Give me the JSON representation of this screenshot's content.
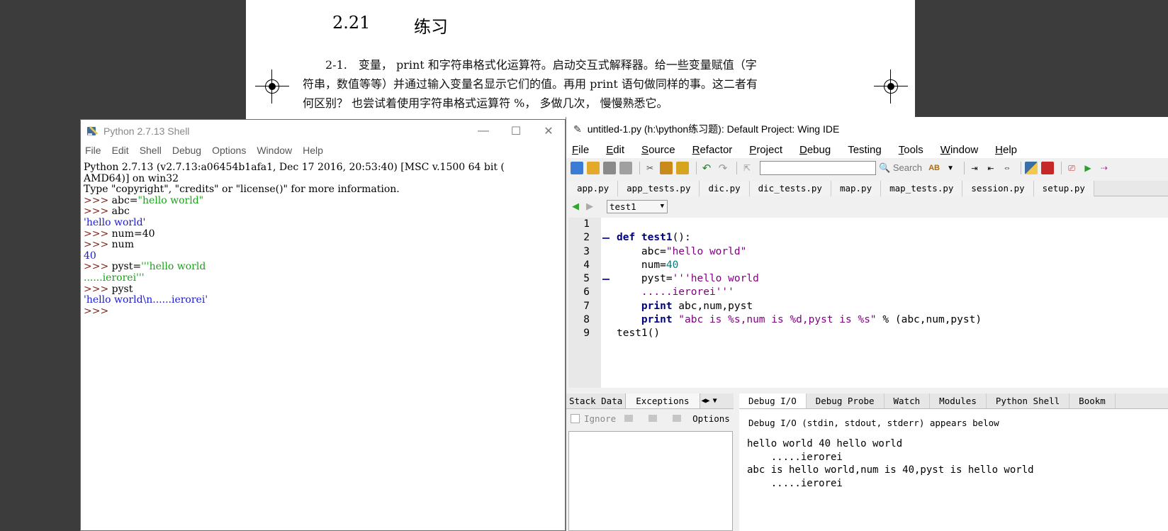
{
  "doc": {
    "heading_num": "2.21",
    "heading_title": "练习",
    "lines": [
      "　　2-1.　变量， print 和字符串格式化运算符。启动交互式解释器。给一些变量赋值（字",
      "符串，数值等等）并通过输入变量名显示它们的值。再用 print 语句做同样的事。这二者有",
      "何区别？ 也尝试着使用字符串格式运算符 %， 多做几次， 慢慢熟悉它。"
    ]
  },
  "shell": {
    "title": "Python 2.7.13 Shell",
    "controls": {
      "minimize": "—",
      "maximize": "☐",
      "close": "✕"
    },
    "menu": [
      "File",
      "Edit",
      "Shell",
      "Debug",
      "Options",
      "Window",
      "Help"
    ],
    "banner1": "Python 2.7.13 (v2.7.13:a06454b1afa1, Dec 17 2016, 20:53:40) [MSC v.1500 64 bit (",
    "banner2": "AMD64)] on win32",
    "banner3": "Type \"copyright\", \"credits\" or \"license()\" for more information.",
    "prompt": ">>> ",
    "cmd1_var": "abc=",
    "cmd1_str": "\"hello world\"",
    "cmd2": "abc",
    "out2": "'hello world'",
    "cmd3": "num=40",
    "cmd4": "num",
    "out4": "40",
    "cmd5_var": "pyst=",
    "cmd5_str1": "'''hello world",
    "cmd5_str2": "......ierorei'''",
    "cmd6": "pyst",
    "out6": "'hello world\\n......ierorei'",
    "last_prompt": ">>> "
  },
  "wing": {
    "title": "untitled-1.py (h:\\python练习题): Default Project: Wing IDE",
    "menu": [
      {
        "u": "F",
        "rest": "ile"
      },
      {
        "u": "E",
        "rest": "dit"
      },
      {
        "u": "S",
        "rest": "ource"
      },
      {
        "u": "R",
        "rest": "efactor"
      },
      {
        "u": "P",
        "rest": "roject"
      },
      {
        "u": "D",
        "rest": "ebug"
      },
      {
        "u": "",
        "rest": "Testing"
      },
      {
        "u": "T",
        "rest": "ools"
      },
      {
        "u": "W",
        "rest": "indow"
      },
      {
        "u": "H",
        "rest": "elp"
      }
    ],
    "search_label": "Search",
    "tabs": [
      "app.py",
      "app_tests.py",
      "dic.py",
      "dic_tests.py",
      "map.py",
      "map_tests.py",
      "session.py",
      "setup.py"
    ],
    "function_select": "test1",
    "line_numbers": [
      "1",
      "2",
      "3",
      "4",
      "5",
      "6",
      "7",
      "8",
      "9"
    ],
    "code": {
      "l2_kw": "def ",
      "l2_fn": "test1",
      "l2_rest": "():",
      "l3_a": "    abc=",
      "l3_s": "\"hello world\"",
      "l4_a": "    num=",
      "l4_n": "40",
      "l5_a": "    pyst=",
      "l5_s": "'''hello world",
      "l6_s": "    .....ierorei'''",
      "l7_kw": "    print",
      "l7_rest": " abc,num,pyst",
      "l8_kw": "    print",
      "l8_s": " \"abc is %s,num is %d,pyst is %s\"",
      "l8_rest": " % (abc,num,pyst)",
      "l9": "test1()"
    },
    "bottom_left_tabs": [
      "Stack Data",
      "Exceptions"
    ],
    "ignore_label": "Ignore",
    "options_label": "Options",
    "bottom_right_tabs": [
      "Debug I/O",
      "Debug Probe",
      "Watch",
      "Modules",
      "Python Shell",
      "Bookm"
    ],
    "debug_note": "Debug I/O (stdin, stdout, stderr) appears below",
    "debug_output": [
      "hello world 40 hello world",
      "    .....ierorei",
      "abc is hello world,num is 40,pyst is hello world",
      "    .....ierorei"
    ]
  }
}
